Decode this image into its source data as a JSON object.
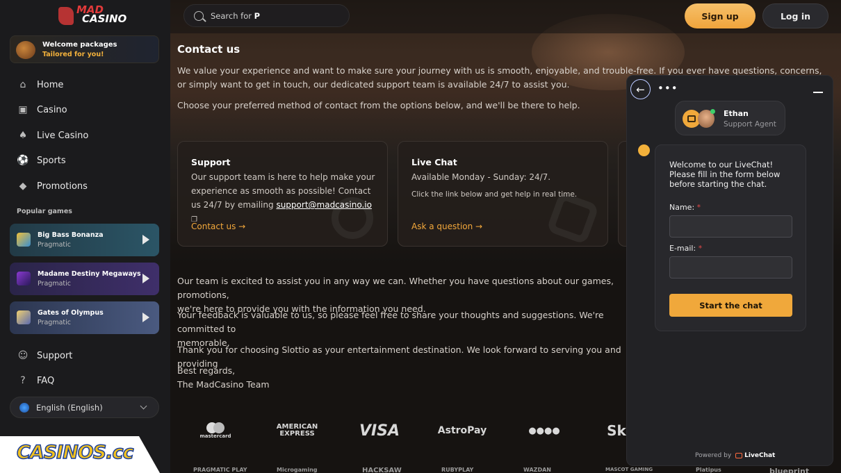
{
  "brand": {
    "logo_top": "MAD",
    "logo_bottom": "CASINO"
  },
  "welcome": {
    "title": "Welcome packages",
    "subtitle": "Tailored for you!"
  },
  "nav": [
    {
      "label": "Home",
      "icon": "home-icon"
    },
    {
      "label": "Casino",
      "icon": "casino-icon"
    },
    {
      "label": "Live Casino",
      "icon": "live-casino-icon"
    },
    {
      "label": "Sports",
      "icon": "sports-icon"
    },
    {
      "label": "Promotions",
      "icon": "promotions-icon"
    }
  ],
  "popular_games_label": "Popular games",
  "games": [
    {
      "name": "Big Bass Bonanza",
      "provider": "Pragmatic"
    },
    {
      "name": "Madame Destiny Megaways",
      "provider": "Pragmatic"
    },
    {
      "name": "Gates of Olympus",
      "provider": "Pragmatic"
    }
  ],
  "bottom_nav": [
    {
      "label": "Support",
      "icon": "support-icon"
    },
    {
      "label": "FAQ",
      "icon": "faq-icon"
    }
  ],
  "language": "English (English)",
  "watermark": "CASINOS.cc",
  "search": {
    "placeholder": "Search for",
    "typed": "P"
  },
  "header": {
    "signup": "Sign up",
    "login": "Log in"
  },
  "page": {
    "title": "Contact us",
    "intro1": "We value your experience and want to make sure your journey with us is smooth, enjoyable, and trouble-free. If you ever have questions, concerns, or simply want to get in touch, our dedicated support team is available 24/7 to assist you.",
    "intro2": "Choose your preferred method of contact from the options below, and we'll be there to help.",
    "body1": "Our team is excited to assist you in any way we can. Whether you have questions about our games, promotions,",
    "body1b": "we're here to provide you with the information you need.",
    "body2": "Your feedback is valuable to us, so please feel free to share your thoughts and suggestions. We're committed to",
    "body2b": "memorable.",
    "body3": "Thank you for choosing Slottio as your entertainment destination. We look forward to serving you and providing",
    "regards": "Best regards,",
    "team": "The MadCasino Team"
  },
  "cards": [
    {
      "title": "Support",
      "text": "Our support team is here to help make your experience as smooth as possible! Contact us 24/7 by emailing",
      "email": "support@madcasino.io",
      "link": "Contact us →"
    },
    {
      "title": "Live Chat",
      "text": "Available Monday - Sunday: 24/7.",
      "small": "Click the link below and get help in real time.",
      "link": "Ask a question →"
    }
  ],
  "payments": [
    "mastercard",
    "AMERICAN EXPRESS",
    "VISA",
    "AstroPay",
    "●●●●",
    "Sk"
  ],
  "providers": [
    "PRAGMATIC PLAY",
    "Microgaming",
    "HACKSAW",
    "RUBYPLAY",
    "WAZDAN",
    "MASCOT GAMING",
    "Platipus",
    "blueprint"
  ],
  "chat": {
    "agent_name": "Ethan",
    "agent_role": "Support Agent",
    "intro": "Welcome to our LiveChat! Please fill in the form below before starting the chat.",
    "name_label": "Name:",
    "email_label": "E-mail:",
    "required_mark": "*",
    "start": "Start the chat",
    "powered_by": "Powered by",
    "powered_brand": "LiveChat",
    "more": "•••"
  },
  "colors": {
    "accent": "#f0a83b",
    "background": "#141414",
    "sidebar": "#1b1b1d",
    "panel": "#222225"
  }
}
